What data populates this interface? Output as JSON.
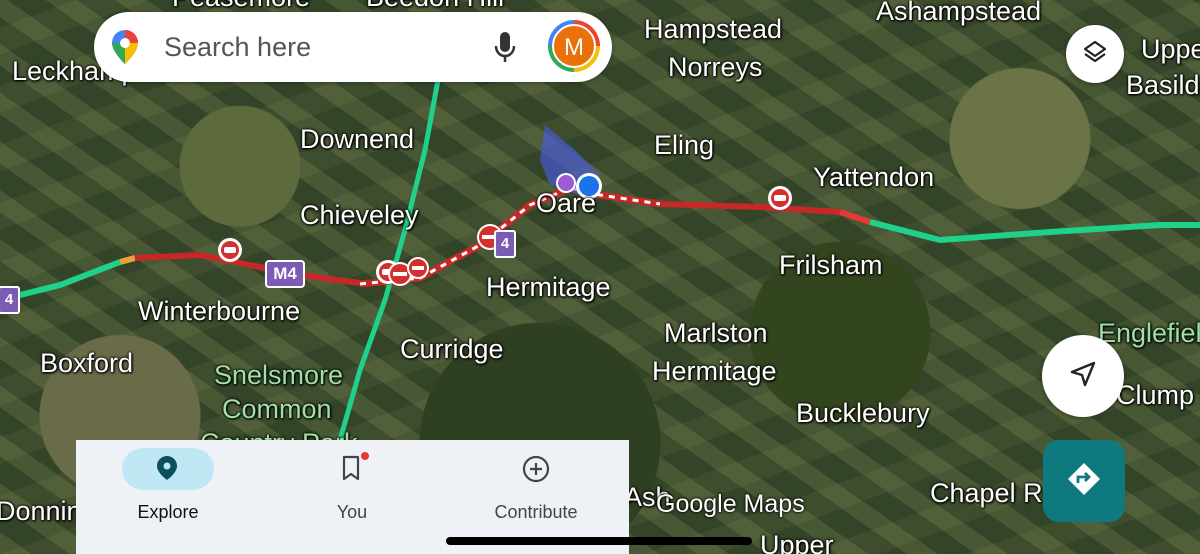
{
  "search": {
    "placeholder": "Search here"
  },
  "account": {
    "initial": "M"
  },
  "places": [
    {
      "name": "Peasemore"
    },
    {
      "name": "Beedon Hill"
    },
    {
      "name": "Leckhampstead"
    },
    {
      "name": "Hampstead"
    },
    {
      "name": "Norreys"
    },
    {
      "name": "Ashampstead"
    },
    {
      "name": "Upper"
    },
    {
      "name": "Basildon"
    },
    {
      "name": "Downend"
    },
    {
      "name": "Eling"
    },
    {
      "name": "Chieveley"
    },
    {
      "name": "Oare"
    },
    {
      "name": "Yattendon"
    },
    {
      "name": "Frilsham"
    },
    {
      "name": "Winterbourne"
    },
    {
      "name": "Hermitage"
    },
    {
      "name": "Curridge"
    },
    {
      "name": "Marlston"
    },
    {
      "name": "Hermitage"
    },
    {
      "name": "Boxford"
    },
    {
      "name": "Snelsmore"
    },
    {
      "name": "Common"
    },
    {
      "name": "Country Park"
    },
    {
      "name": "Bucklebury"
    },
    {
      "name": "Englefield"
    },
    {
      "name": "Clump"
    },
    {
      "name": "Chapel Row"
    },
    {
      "name": "Donnington"
    },
    {
      "name": "Upper"
    },
    {
      "name": "Ash"
    }
  ],
  "roads": {
    "motorway_label": "M4",
    "motorway_label_left": "4"
  },
  "map_controls": {
    "layers_icon": "layers-icon",
    "locate_icon": "navigation-arrow-icon",
    "directions_icon": "directions-icon"
  },
  "bottom_nav": {
    "items": [
      {
        "label": "Explore",
        "icon": "location-pin-icon",
        "active": true
      },
      {
        "label": "You",
        "icon": "bookmark-icon",
        "active": false
      },
      {
        "label": "Contribute",
        "icon": "add-circle-icon",
        "active": false
      }
    ]
  },
  "branding": {
    "watermark": "Google Maps"
  },
  "colors": {
    "traffic_free": "#1fd18a",
    "traffic_heavy": "#c62828",
    "traffic_slow": "#e9a23b",
    "accent": "#0e7a80",
    "nav_active": "#bfe7f4"
  }
}
